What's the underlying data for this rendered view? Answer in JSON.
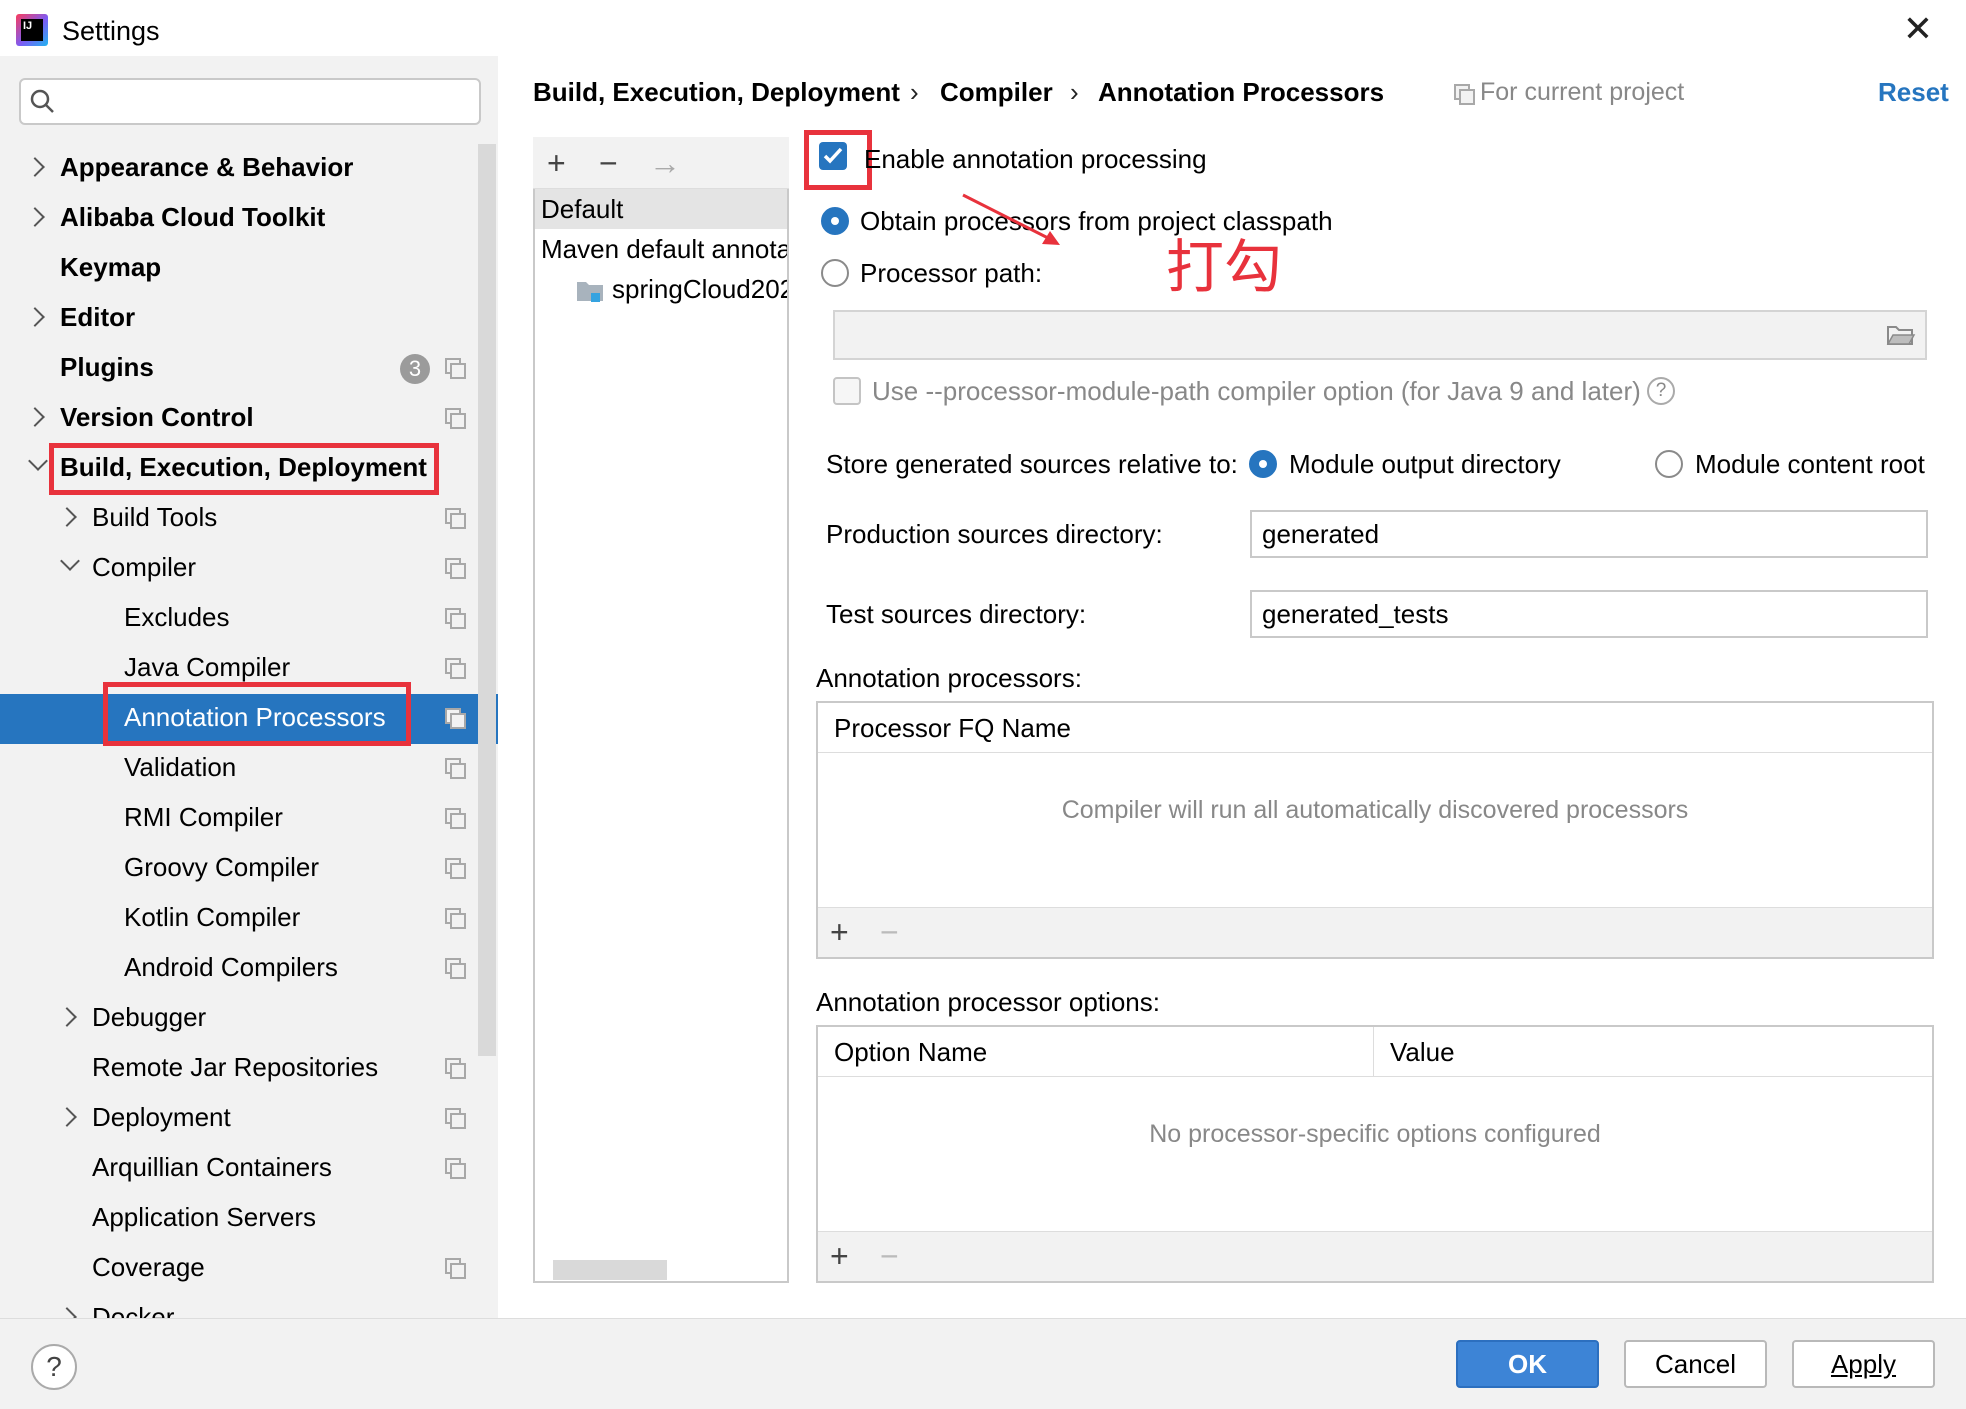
{
  "window": {
    "title": "Settings",
    "icon_text": "IJ",
    "close_icon": "close-icon"
  },
  "sidebar": {
    "search_placeholder": "Q▾",
    "items": [
      {
        "label": "Appearance & Behavior"
      },
      {
        "label": "Alibaba Cloud Toolkit"
      },
      {
        "label": "Keymap"
      },
      {
        "label": "Editor"
      },
      {
        "label": "Plugins",
        "badge": "3"
      },
      {
        "label": "Version Control"
      },
      {
        "label": "Build, Execution, Deployment"
      },
      {
        "label": "Build Tools"
      },
      {
        "label": "Compiler"
      },
      {
        "label": "Excludes"
      },
      {
        "label": "Java Compiler"
      },
      {
        "label": "Annotation Processors"
      },
      {
        "label": "Validation"
      },
      {
        "label": "RMI Compiler"
      },
      {
        "label": "Groovy Compiler"
      },
      {
        "label": "Kotlin Compiler"
      },
      {
        "label": "Android Compilers"
      },
      {
        "label": "Debugger"
      },
      {
        "label": "Remote Jar Repositories"
      },
      {
        "label": "Deployment"
      },
      {
        "label": "Arquillian Containers"
      },
      {
        "label": "Application Servers"
      },
      {
        "label": "Coverage"
      },
      {
        "label": "Docker"
      }
    ]
  },
  "breadcrumb": {
    "part1": "Build, Execution, Deployment",
    "part2": "Compiler",
    "part3": "Annotation Processors",
    "separator": "›",
    "scope": "For current project",
    "reset": "Reset"
  },
  "profiles": {
    "toolbar": {
      "add": "+",
      "remove": "−",
      "move": "→"
    },
    "default": "Default",
    "maven": "Maven default annota",
    "module": "springCloud202"
  },
  "settings": {
    "enable_label": "Enable annotation processing",
    "enable_checked": true,
    "obtain_label": "Obtain processors from project classpath",
    "processor_path_label": "Processor path:",
    "processor_path_value": "",
    "module_path_label": "Use --processor-module-path compiler option (for Java 9 and later)",
    "store_label": "Store generated sources relative to:",
    "module_output_label": "Module output directory",
    "module_content_label": "Module content root",
    "production_label": "Production sources directory:",
    "production_value": "generated",
    "test_label": "Test sources directory:",
    "test_value": "generated_tests",
    "processors_title": "Annotation processors:",
    "processors_column": "Processor FQ Name",
    "processors_empty": "Compiler will run all automatically discovered processors",
    "options_title": "Annotation processor options:",
    "options_col1": "Option Name",
    "options_col2": "Value",
    "options_empty": "No processor-specific options configured",
    "add": "+",
    "remove": "−"
  },
  "annotation_text": "打勾",
  "buttons": {
    "help": "?",
    "ok": "OK",
    "cancel": "Cancel",
    "apply": "Apply"
  },
  "colors": {
    "accent": "#2675bf",
    "highlight_box": "#e8323c",
    "sidebar_bg": "#f2f2f2"
  }
}
